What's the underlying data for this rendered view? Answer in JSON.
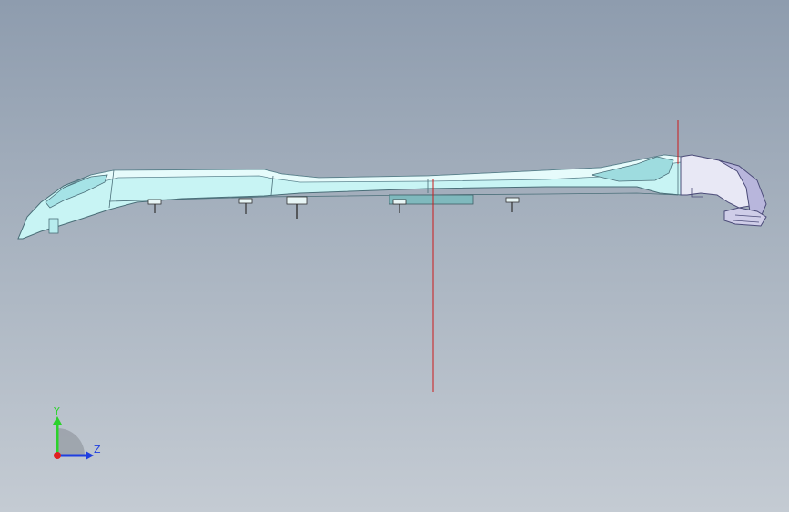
{
  "viewport": {
    "background_top": "#8e9cae",
    "background_bottom": "#c4cbd3",
    "model": {
      "part_fill": "#c8f4f4",
      "part_edge": "#4a6e78",
      "end_cap_fill": "#c9c8e6",
      "fastener_count": 5
    },
    "reference_lines_color": "#cc1a1a"
  },
  "triad": {
    "y_label": "Y",
    "z_label": "Z",
    "y_color": "#2bd22b",
    "z_color": "#1f3fe0",
    "x_color": "#e02020"
  }
}
